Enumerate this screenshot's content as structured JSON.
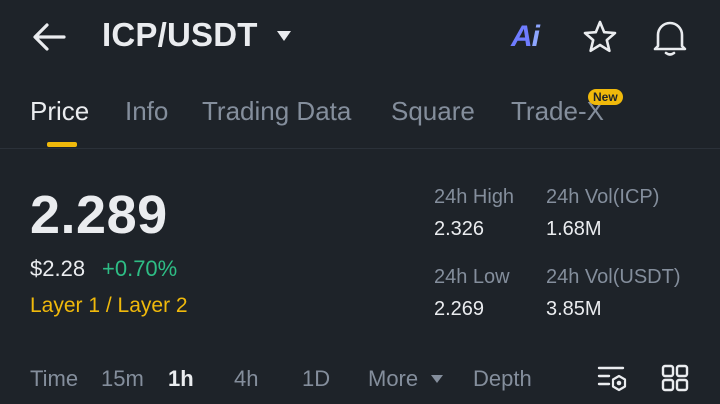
{
  "header": {
    "pair": "ICP/USDT",
    "ai_letters": [
      "A",
      "i"
    ]
  },
  "tabs": [
    {
      "label": "Price",
      "active": true
    },
    {
      "label": "Info",
      "active": false
    },
    {
      "label": "Trading Data",
      "active": false
    },
    {
      "label": "Square",
      "active": false
    },
    {
      "label": "Trade-X",
      "active": false,
      "badge": "New"
    }
  ],
  "ticker": {
    "last_price": "2.289",
    "usd_price": "$2.28",
    "change_pct": "+0.70%",
    "tags": "Layer 1 / Layer 2",
    "stats": {
      "high_label": "24h High",
      "high_value": "2.326",
      "low_label": "24h Low",
      "low_value": "2.269",
      "vol_base_label": "24h Vol(ICP)",
      "vol_base_value": "1.68M",
      "vol_quote_label": "24h Vol(USDT)",
      "vol_quote_value": "3.85M"
    }
  },
  "intervals": {
    "time": "Time",
    "m15": "15m",
    "h1": "1h",
    "h4": "4h",
    "d1": "1D",
    "more": "More",
    "depth": "Depth",
    "selected": "1h"
  },
  "colors": {
    "background": "#1e2329",
    "accent": "#f0b90b",
    "positive": "#2ebd85",
    "muted": "#848e9c",
    "primary_text": "#eaecef"
  }
}
